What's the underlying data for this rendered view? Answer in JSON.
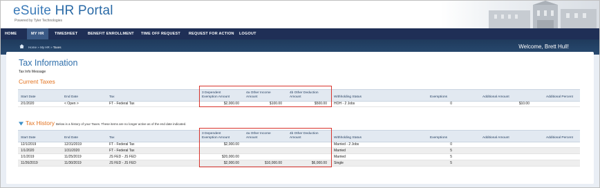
{
  "header": {
    "brand_prefix": "eSuite ",
    "brand_main": "HR Portal",
    "powered_by": "Powered by Tyler Technologies"
  },
  "nav": {
    "items": [
      "HOME",
      "MY HR",
      "TIMESHEET",
      "BENEFIT ENROLLMENT",
      "TIME OFF REQUEST",
      "REQUEST FOR ACTION",
      "LOGOUT"
    ],
    "active": "MY HR"
  },
  "breadcrumb": {
    "home": "Home",
    "sep1": "»",
    "myhr": "My HR",
    "sep2": "»",
    "current": "Taxes"
  },
  "welcome": "Welcome, Brett Hull!",
  "page": {
    "title": "Tax Information",
    "message": "Tax Info Message",
    "current_title": "Current Taxes",
    "history_title": "Tax History",
    "history_note": "Below is a history of your Taxes. These items are no longer active as of the end date indicated."
  },
  "columns": {
    "start": "Start Date",
    "end": "End Date",
    "tax": "Tax",
    "dep_1": "3 Dependent",
    "dep_2": "Exemption Amount",
    "oi_1": "4a Other Income",
    "oi_2": "Amount",
    "od_1": "4b Other Deduction",
    "od_2": "Amount",
    "status": "Withholding Status",
    "exemptions": "Exemptions",
    "add_amount": "Additional Amount",
    "add_percent": "Additional Percent"
  },
  "current_rows": [
    {
      "start": "2/1/2020",
      "end": "< Open >",
      "tax": "FT - Federal Tax",
      "dep": "$2,000.00",
      "oi": "$100.00",
      "od": "$500.00",
      "status": "HOH - 2 Jobs",
      "exemptions": "0",
      "add_amount": "$10.00",
      "add_percent": ""
    }
  ],
  "history_rows": [
    {
      "start": "12/1/2019",
      "end": "12/31/2019",
      "tax": "FT - Federal Tax",
      "dep": "$2,000.00",
      "oi": "",
      "od": "",
      "status": "Married - 2 Jobs",
      "exemptions": "0",
      "add_amount": "",
      "add_percent": ""
    },
    {
      "start": "1/1/2020",
      "end": "1/31/2020",
      "tax": "FT - Federal Tax",
      "dep": "",
      "oi": "",
      "od": "",
      "status": "Married",
      "exemptions": "5",
      "add_amount": "",
      "add_percent": ""
    },
    {
      "start": "1/1/2019",
      "end": "11/25/2019",
      "tax": "JS FED - JS FED",
      "dep": "$20,000.00",
      "oi": "",
      "od": "",
      "status": "Married",
      "exemptions": "5",
      "add_amount": "",
      "add_percent": ""
    },
    {
      "start": "11/26/2019",
      "end": "11/30/2019",
      "tax": "JS FED - JS FED",
      "dep": "$2,000.00",
      "oi": "$10,000.00",
      "od": "$6,000.00",
      "status": "Single",
      "exemptions": "5",
      "add_amount": "",
      "add_percent": ""
    }
  ],
  "colors": {
    "nav_bg": "#1f2f56",
    "accent_orange": "#e2711d",
    "title_blue": "#2f6fab",
    "highlight_red": "#d8322b"
  },
  "icons": {
    "home": "home-icon",
    "history_toggle": "triangle-down-icon"
  }
}
